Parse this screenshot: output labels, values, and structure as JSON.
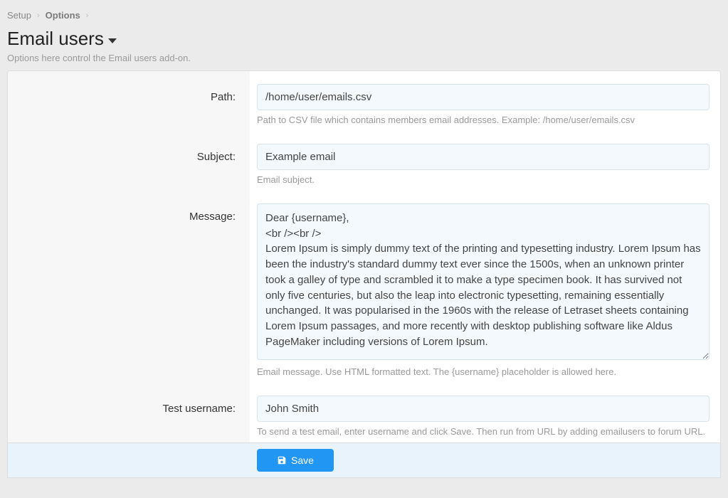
{
  "breadcrumb": {
    "setup": "Setup",
    "options": "Options"
  },
  "page": {
    "title": "Email users",
    "subtitle": "Options here control the Email users add-on."
  },
  "form": {
    "path": {
      "label": "Path:",
      "value": "/home/user/emails.csv",
      "help": "Path to CSV file which contains members email addresses. Example: /home/user/emails.csv"
    },
    "subject": {
      "label": "Subject:",
      "value": "Example email",
      "help": "Email subject."
    },
    "message": {
      "label": "Message:",
      "value": "Dear {username},\n<br /><br />\nLorem Ipsum is simply dummy text of the printing and typesetting industry. Lorem Ipsum has been the industry's standard dummy text ever since the 1500s, when an unknown printer took a galley of type and scrambled it to make a type specimen book. It has survived not only five centuries, but also the leap into electronic typesetting, remaining essentially unchanged. It was popularised in the 1960s with the release of Letraset sheets containing Lorem Ipsum passages, and more recently with desktop publishing software like Aldus PageMaker including versions of Lorem Ipsum.",
      "help": "Email message. Use HTML formatted text. The {username} placeholder is allowed here."
    },
    "test_username": {
      "label": "Test username:",
      "value": "John Smith",
      "help": "To send a test email, enter username and click Save. Then run from URL by adding emailusers to forum URL."
    }
  },
  "actions": {
    "save": "Save"
  }
}
